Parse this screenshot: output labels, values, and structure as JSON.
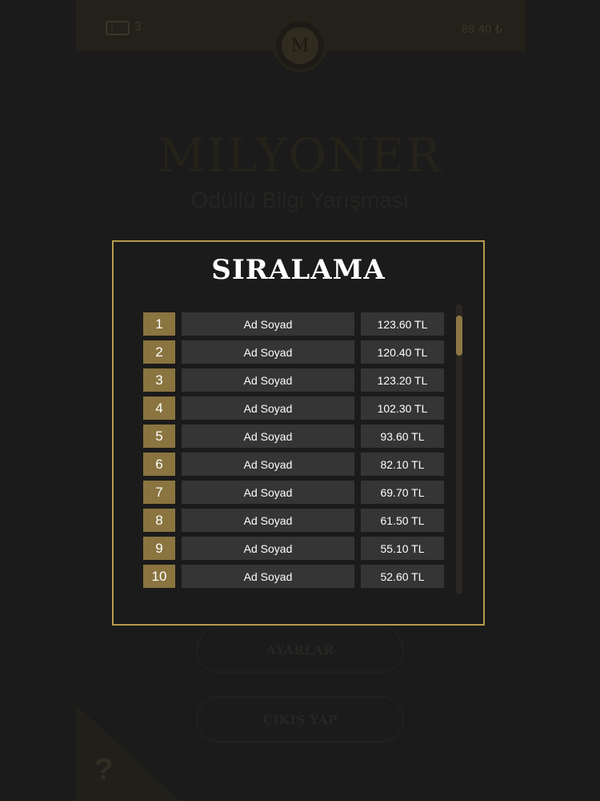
{
  "background": {
    "ticket_count": "3",
    "balance": "89.40 ₺",
    "avatar_letter": "M",
    "brand": "MILYONER",
    "tagline": "Ödüllü Bilgi Yarışması",
    "settings_label": "AYARLAR",
    "exit_label": "ÇIKIŞ YAP",
    "help_label": "?"
  },
  "modal": {
    "title": "SIRALAMA",
    "rows": [
      {
        "rank": "1",
        "name": "Ad Soyad",
        "amount": "123.60 TL"
      },
      {
        "rank": "2",
        "name": "Ad Soyad",
        "amount": "120.40 TL"
      },
      {
        "rank": "3",
        "name": "Ad Soyad",
        "amount": "123.20 TL"
      },
      {
        "rank": "4",
        "name": "Ad Soyad",
        "amount": "102.30 TL"
      },
      {
        "rank": "5",
        "name": "Ad Soyad",
        "amount": "93.60 TL"
      },
      {
        "rank": "6",
        "name": "Ad Soyad",
        "amount": "82.10 TL"
      },
      {
        "rank": "7",
        "name": "Ad Soyad",
        "amount": "69.70 TL"
      },
      {
        "rank": "8",
        "name": "Ad Soyad",
        "amount": "61.50 TL"
      },
      {
        "rank": "9",
        "name": "Ad Soyad",
        "amount": "55.10 TL"
      },
      {
        "rank": "10",
        "name": "Ad Soyad",
        "amount": "52.60 TL"
      }
    ]
  },
  "colors": {
    "accent_gold": "#b79b4c",
    "rank_bg": "#8a7440",
    "cell_bg": "#353535"
  }
}
